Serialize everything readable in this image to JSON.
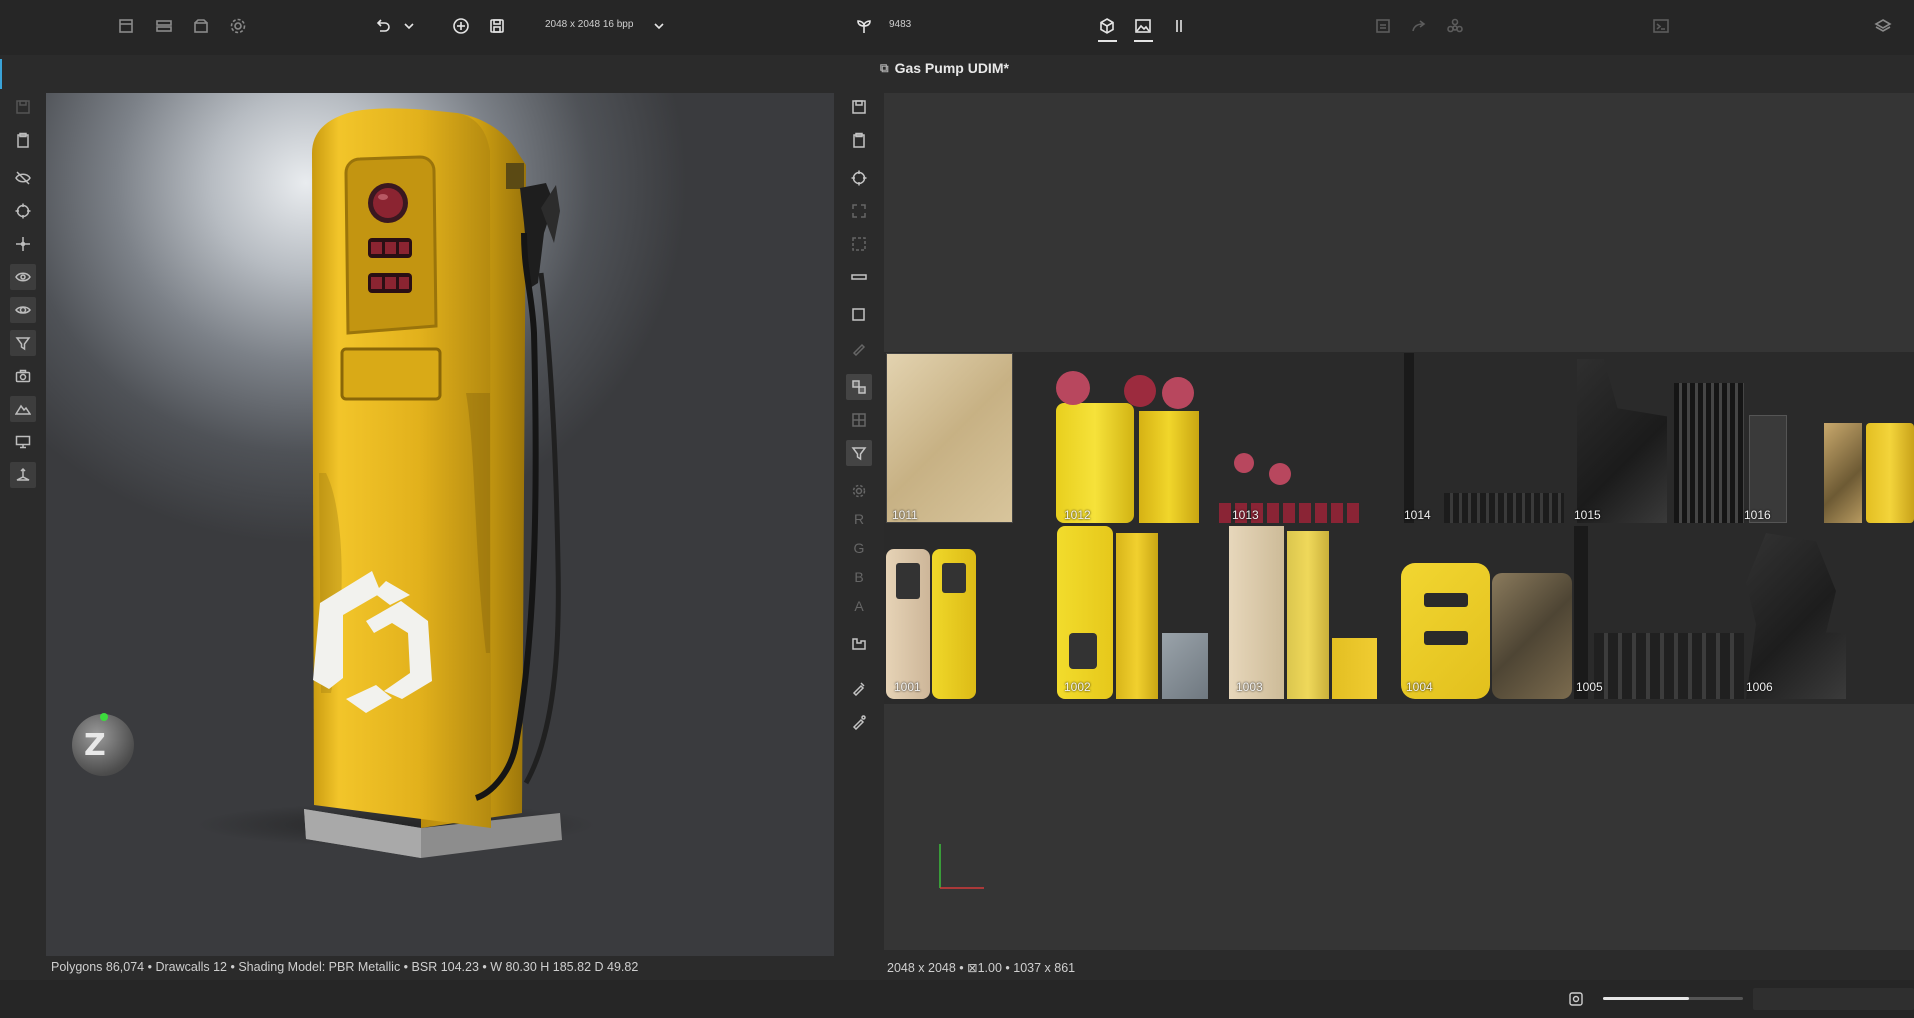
{
  "toolbar": {
    "texture_size": "2048 x 2048 16 bpp",
    "seed_value": "9483",
    "icons": [
      "new-scene-icon",
      "layout-icon",
      "open-package-icon",
      "settings-icon",
      "undo-icon",
      "undo-dropdown-icon",
      "add-icon",
      "save-icon",
      "chevron-down-icon",
      "seed-icon",
      "view-3d-icon",
      "view-2d-icon",
      "split-view-icon",
      "bake-icon",
      "export-icon",
      "share-icon",
      "console-icon",
      "layers-icon"
    ]
  },
  "viewport": {
    "status": "Polygons 86,074 • Drawcalls 12 • Shading Model: PBR Metallic • BSR 104.23 • W 80.30 H 185.82 D 49.82",
    "gizmo_label": "Z"
  },
  "texture": {
    "title": "Gas Pump UDIM*",
    "status": "2048 x 2048 • ⊠1.00 • 1037 x 861",
    "channels": [
      "R",
      "G",
      "B",
      "A"
    ],
    "udim_tiles": [
      "1011",
      "1012",
      "1013",
      "1014",
      "1015",
      "1016",
      "1001",
      "1002",
      "1003",
      "1004",
      "1005",
      "1006"
    ]
  },
  "colors": {
    "pump_yellow": "#e0b21a",
    "panel_bg": "#2b2b2b",
    "texture_bg": "#353535"
  }
}
